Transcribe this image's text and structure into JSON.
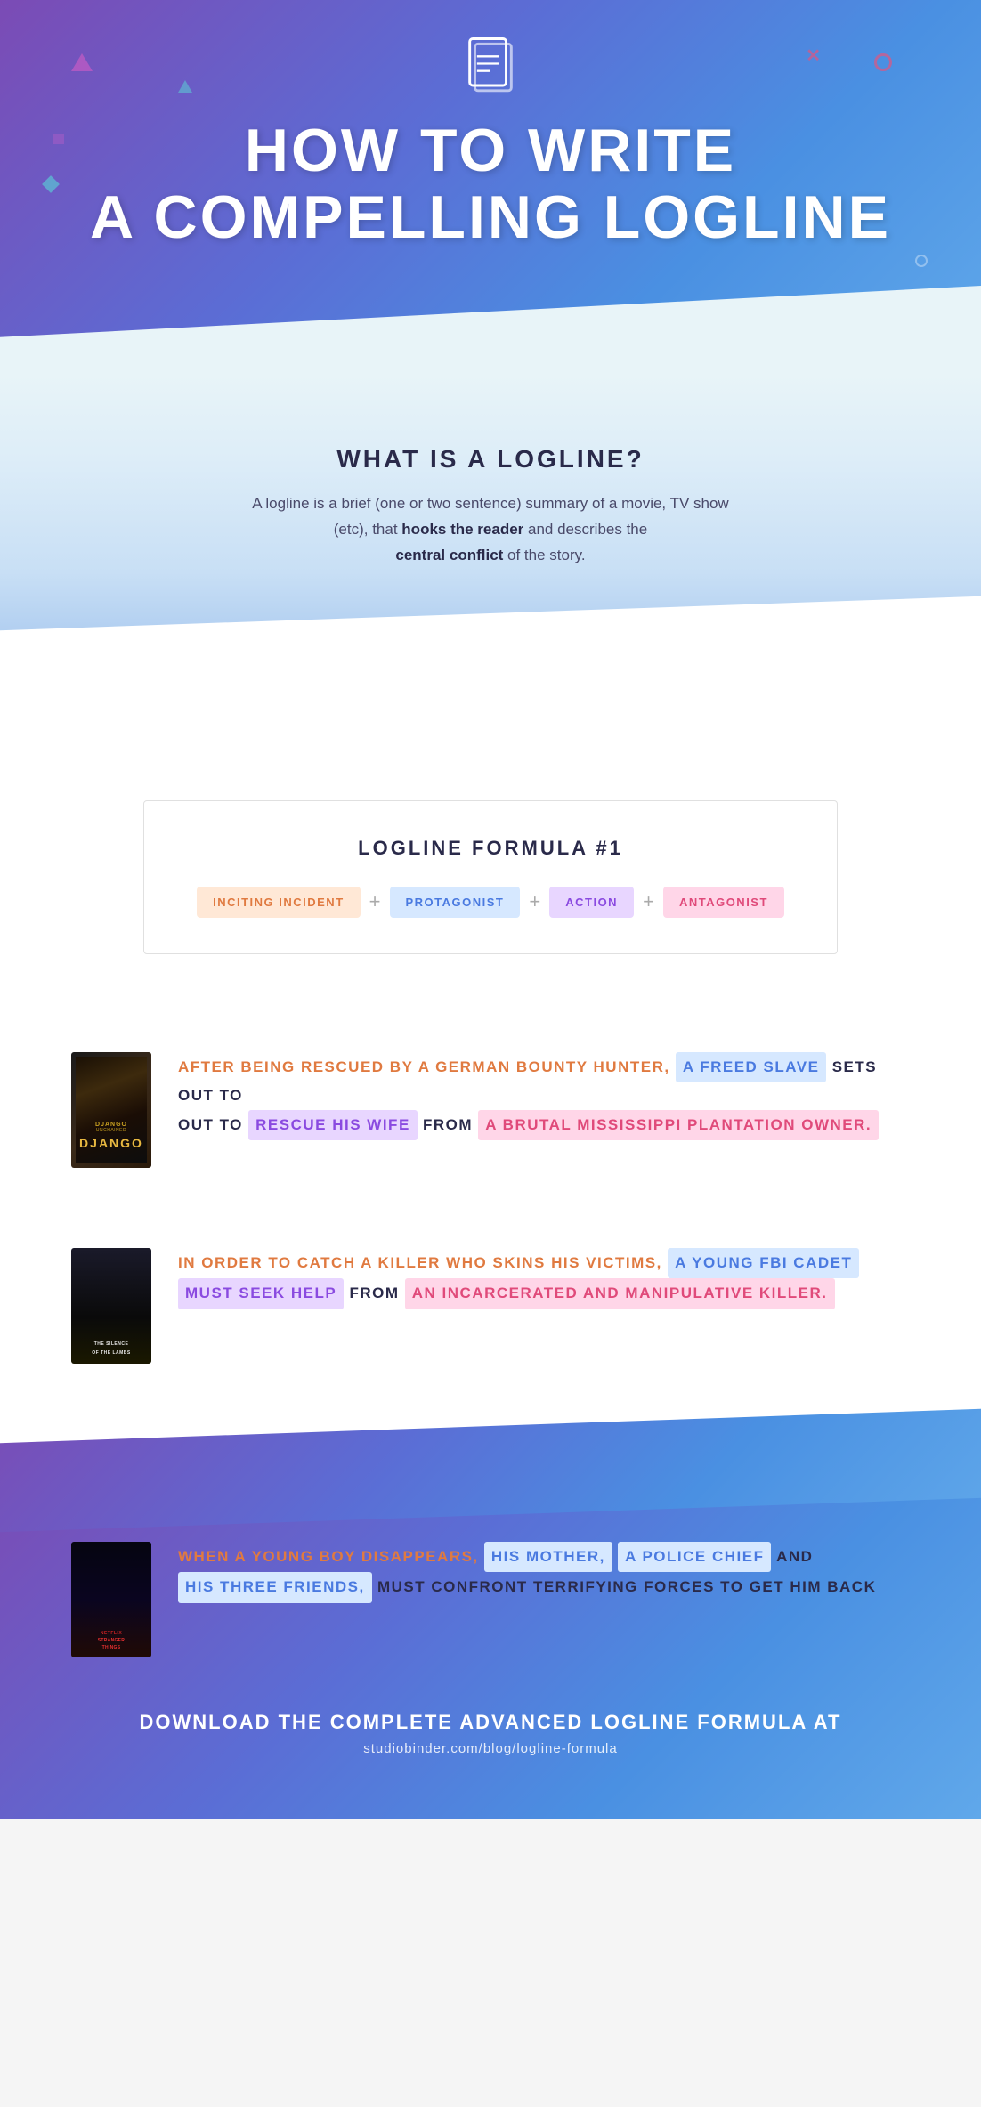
{
  "hero": {
    "title_line1": "HOW TO WRITE",
    "title_line2": "A COMPELLING LOGLINE"
  },
  "what_is_logline": {
    "title": "WHAT IS A LOGLINE?",
    "body_plain": "A logline is a brief (one or two sentence) summary of a movie, TV show (etc), that ",
    "body_bold_1": "hooks the reader",
    "body_mid": " and describes the ",
    "body_bold_2": "central conflict",
    "body_end": " of the story."
  },
  "formula": {
    "title": "LOGLINE FORMULA #1",
    "pill_1": "INCITING INCIDENT",
    "plus_1": "+",
    "pill_2": "PROTAGONIST",
    "plus_2": "+",
    "pill_3": "ACTION",
    "plus_3": "+",
    "pill_4": "ANTAGONIST"
  },
  "examples": {
    "django": {
      "poster_label": "DJANGO",
      "text_intro": "AFTER BEING RESCUED BY A GERMAN BOUNTY HUNTER,",
      "protagonist": "A FREED SLAVE",
      "text_mid": "SETS OUT TO",
      "action": "RESCUE HIS WIFE",
      "text_from": "FROM",
      "antagonist": "A BRUTAL MISSISSIPPI PLANTATION OWNER."
    },
    "silence": {
      "poster_label": "THE SILENCE OF THE LAMBS",
      "text_intro": "IN ORDER TO CATCH A KILLER WHO SKINS HIS VICTIMS,",
      "protagonist": "A YOUNG FBI CADET",
      "action": "MUST SEEK HELP",
      "text_from": "FROM",
      "antagonist": "AN INCARCERATED AND MANIPULATIVE KILLER."
    },
    "stranger_things": {
      "poster_label": "STRANGER THINGS",
      "text_intro": "WHEN A YOUNG BOY DISAPPEARS,",
      "protagonist_1": "HIS MOTHER,",
      "protagonist_2": "A POLICE CHIEF",
      "text_and": "AND",
      "protagonist_3": "HIS THREE FRIENDS,",
      "action": "MUST CONFRONT",
      "antagonist": "TERRIFYING FORCES TO GET HIM BACK"
    }
  },
  "download": {
    "title": "DOWNLOAD THE COMPLETE ADVANCED LOGLINE FORMULA AT",
    "url": "studiobinder.com/blog/logline-formula"
  }
}
